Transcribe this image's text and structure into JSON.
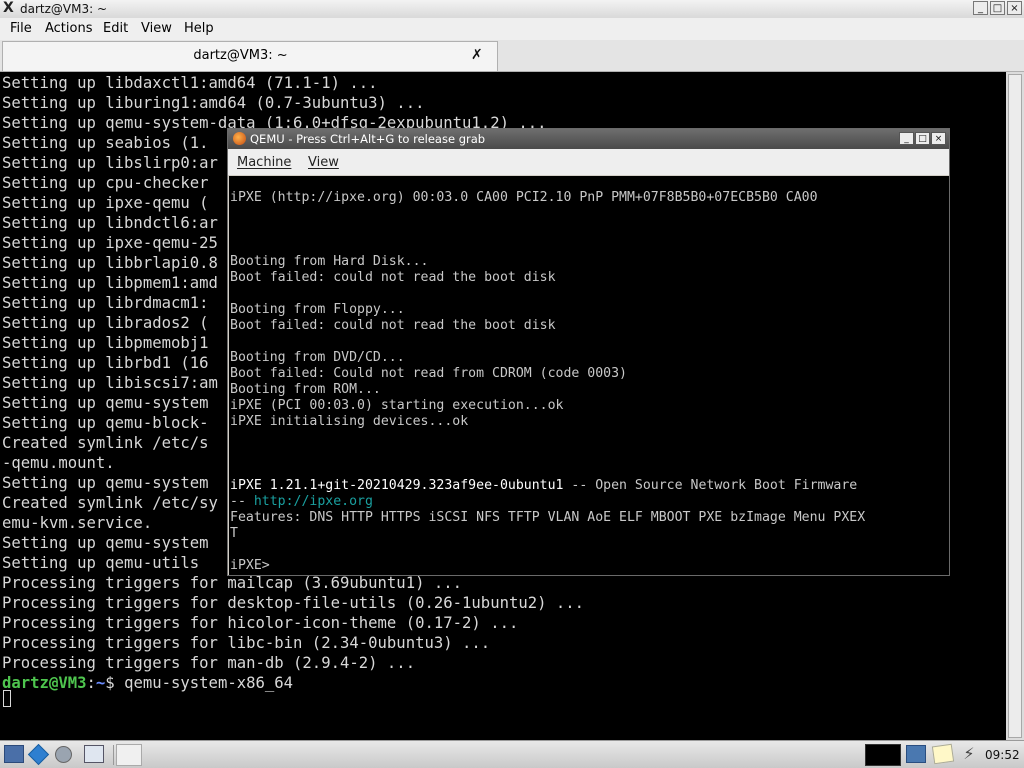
{
  "window": {
    "title": "dartz@VM3: ~",
    "controls": {
      "minimize": "_",
      "maximize": "□",
      "close": "×"
    }
  },
  "menu": [
    "File",
    "Actions",
    "Edit",
    "View",
    "Help"
  ],
  "tab": {
    "label": "dartz@VM3: ~",
    "close": "✗"
  },
  "terminal": {
    "lines": [
      "Setting up libdaxctl1:amd64 (71.1-1) ...",
      "Setting up liburing1:amd64 (0.7-3ubuntu3) ...",
      "Setting up qemu-system-data (1:6.0+dfsg-2expubuntu1.2) ...",
      "Setting up seabios (1.",
      "Setting up libslirp0:ar",
      "Setting up cpu-checker",
      "Setting up ipxe-qemu (",
      "Setting up libndctl6:ar",
      "Setting up ipxe-qemu-25",
      "Setting up libbrlapi0.8",
      "Setting up libpmem1:amd",
      "Setting up librdmacm1:",
      "Setting up librados2 (",
      "Setting up libpmemobj1",
      "Setting up librbd1 (16",
      "Setting up libiscsi7:am",
      "Setting up qemu-system",
      "Setting up qemu-block-",
      "Created symlink /etc/s                                                       m/run",
      "-qemu.mount.",
      "Setting up qemu-system",
      "Created symlink /etc/sy                                                      stem/q",
      "emu-kvm.service.",
      "Setting up qemu-system",
      "Setting up qemu-utils",
      "Processing triggers for mailcap (3.69ubuntu1) ...",
      "Processing triggers for desktop-file-utils (0.26-1ubuntu2) ...",
      "Processing triggers for hicolor-icon-theme (0.17-2) ...",
      "Processing triggers for libc-bin (2.34-0ubuntu3) ...",
      "Processing triggers for man-db (2.9.4-2) ..."
    ],
    "prompt": {
      "user": "dartz@VM3",
      "sep": ":",
      "path": "~",
      "symbol": "$ ",
      "command": "qemu-system-x86_64"
    }
  },
  "qemu": {
    "title": "QEMU - Press Ctrl+Alt+G to release grab",
    "controls": {
      "minimize": "_",
      "maximize": "□",
      "close": "×"
    },
    "menu": [
      "Machine",
      "View"
    ],
    "screen": {
      "ipxe_header": "iPXE (http://ipxe.org) 00:03.0 CA00 PCI2.10 PnP PMM+07F8B5B0+07ECB5B0 CA00",
      "boot_hd": "Booting from Hard Disk...",
      "boot_hd_fail": "Boot failed: could not read the boot disk",
      "boot_floppy": "Booting from Floppy...",
      "boot_floppy_fail": "Boot failed: could not read the boot disk",
      "boot_dvd": "Booting from DVD/CD...",
      "boot_dvd_fail": "Boot failed: Could not read from CDROM (code 0003)",
      "boot_rom": "Booting from ROM...",
      "ipxe_start": "iPXE (PCI 00:03.0) starting execution...ok",
      "ipxe_init": "iPXE initialising devices...ok",
      "ipxe_version": "iPXE 1.21.1+git-20210429.323af9ee-0ubuntu1",
      "ipxe_version_suffix": " -- Open Source Network Boot Firmware",
      "ipxe_dash": "-- ",
      "ipxe_link": "http://ipxe.org",
      "features_1": "Features: DNS HTTP HTTPS iSCSI NFS TFTP VLAN AoE ELF MBOOT PXE bzImage Menu PXEX",
      "features_2": "T",
      "ipxe_prompt": "iPXE>"
    }
  },
  "taskbar": {
    "clock": "09:52"
  }
}
